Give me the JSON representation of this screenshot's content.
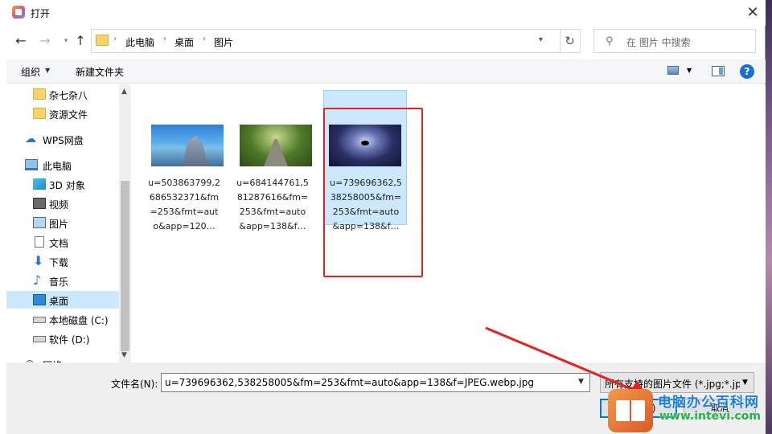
{
  "window": {
    "title": "打开",
    "close_glyph": "✕"
  },
  "address": {
    "breadcrumbs": [
      "此电脑",
      "桌面",
      "图片"
    ],
    "search_placeholder": "在 图片 中搜索"
  },
  "toolbar": {
    "organize": "组织",
    "new_folder": "新建文件夹",
    "help": "?"
  },
  "nav_items": [
    {
      "label": "杂七杂八",
      "icon": "folder-icon"
    },
    {
      "label": "资源文件",
      "icon": "folder-icon"
    },
    {
      "label": "WPS网盘",
      "icon": "cloud-icon"
    },
    {
      "label": "此电脑",
      "icon": "computer-icon"
    },
    {
      "label": "3D 对象",
      "icon": "3d-objects-icon"
    },
    {
      "label": "视频",
      "icon": "video-icon"
    },
    {
      "label": "图片",
      "icon": "pictures-icon"
    },
    {
      "label": "文档",
      "icon": "documents-icon"
    },
    {
      "label": "下载",
      "icon": "download-icon"
    },
    {
      "label": "音乐",
      "icon": "music-icon"
    },
    {
      "label": "桌面",
      "icon": "desktop-icon",
      "selected": true
    },
    {
      "label": "本地磁盘 (C:)",
      "icon": "drive-icon"
    },
    {
      "label": "软件 (D:)",
      "icon": "drive-icon"
    },
    {
      "label": "网络",
      "icon": "network-icon"
    }
  ],
  "files": [
    {
      "name": "u=503863799,2686532371&fm=253&fmt=auto&app=120…",
      "lines": [
        "u=503863799,2",
        "686532371&fm",
        "=253&fmt=aut",
        "o&app=120…"
      ],
      "thumbnail": "mountain-image"
    },
    {
      "name": "u=684144761,581287616&fm=253&fmt=auto&app=138&f…",
      "lines": [
        "u=684144761,5",
        "81287616&fm=",
        "253&fmt=auto",
        "&app=138&f…"
      ],
      "thumbnail": "tree-road-image"
    },
    {
      "name": "u=739696362,538258005&fm=253&fmt=auto&app=138&f…",
      "lines": [
        "u=739696362,5",
        "38258005&fm=",
        "253&fmt=auto",
        "&app=138&f…"
      ],
      "thumbnail": "space-eye-image",
      "selected": true
    }
  ],
  "bottom": {
    "filename_label": "文件名(N):",
    "filename_value": "u=739696362,538258005&fm=253&fmt=auto&app=138&f=JPEG.webp.jpg",
    "filter_value": "所有支持的图片文件 (*.jpg;*.jp",
    "open_button": "打开(O)",
    "cancel_button": "取消"
  },
  "watermark": {
    "title": "电脑办公百科网",
    "url": "www.intevi.com"
  },
  "colors": {
    "selection": "#cce8ff",
    "annotation_red": "#e8201f",
    "accent": "#0078d7"
  }
}
